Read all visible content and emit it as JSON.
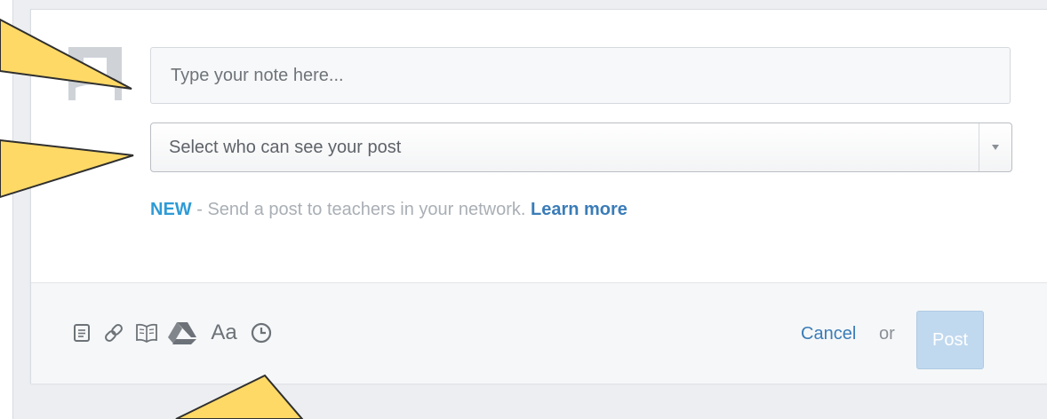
{
  "composer": {
    "note_placeholder": "Type your note here...",
    "audience_select": {
      "selected_text": "Select who can see your post"
    },
    "notice": {
      "tag": "NEW",
      "text": " - Send a post to teachers in your network. ",
      "link": "Learn more"
    }
  },
  "toolbar": {
    "tools": [
      {
        "icon": "note-icon"
      },
      {
        "icon": "link-icon"
      },
      {
        "icon": "book-icon"
      },
      {
        "icon": "google-drive-icon"
      },
      {
        "icon": "text-format-icon",
        "label": "Aa"
      },
      {
        "icon": "clock-icon"
      }
    ],
    "cancel_label": "Cancel",
    "or_label": "or",
    "post_label": "Post"
  },
  "colors": {
    "accent_blue": "#2e9bd6",
    "link_blue": "#3a7cb8",
    "post_button_disabled": "#c1d9ef",
    "callout_yellow": "#ffd966"
  }
}
